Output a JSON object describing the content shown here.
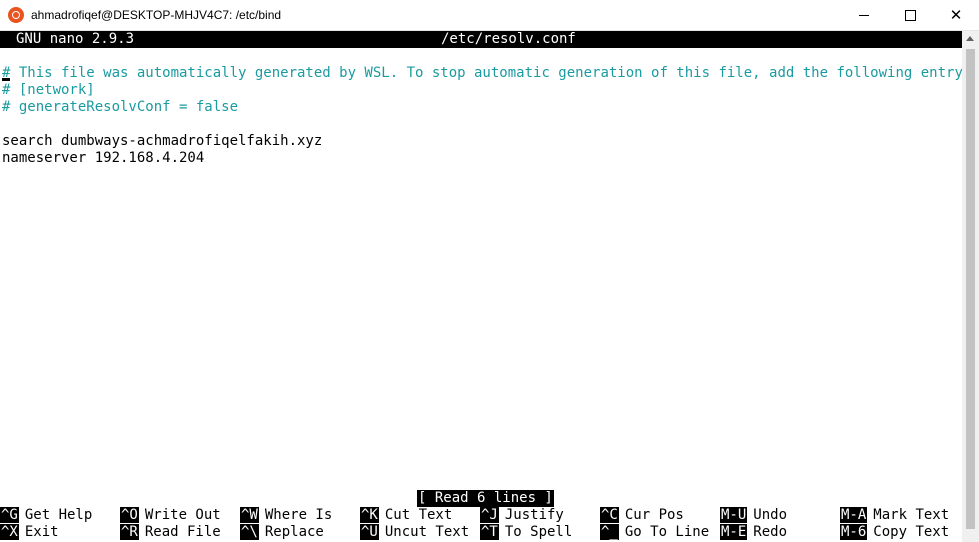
{
  "window": {
    "title": "ahmadrofiqef@DESKTOP-MHJV4C7: /etc/bind",
    "icon": "ubuntu-icon",
    "close_glyph": "✕"
  },
  "editor": {
    "version": "GNU nano 2.9.3",
    "filename": "/etc/resolv.conf",
    "lines": [
      "# This file was automatically generated by WSL. To stop automatic generation of this file, add the following entry to /$",
      "# [network]",
      "# generateResolvConf = false",
      "",
      "search dumbways-achmadrofiqelfakih.xyz",
      "nameserver 192.168.4.204"
    ],
    "status": "[ Read 6 lines ]"
  },
  "shortcuts": {
    "row1": [
      {
        "key": "^G",
        "label": "Get Help"
      },
      {
        "key": "^O",
        "label": "Write Out"
      },
      {
        "key": "^W",
        "label": "Where Is"
      },
      {
        "key": "^K",
        "label": "Cut Text"
      },
      {
        "key": "^J",
        "label": "Justify"
      },
      {
        "key": "^C",
        "label": "Cur Pos"
      },
      {
        "key": "M-U",
        "label": "Undo"
      },
      {
        "key": "M-A",
        "label": "Mark Text"
      }
    ],
    "row2": [
      {
        "key": "^X",
        "label": "Exit"
      },
      {
        "key": "^R",
        "label": "Read File"
      },
      {
        "key": "^\\",
        "label": "Replace"
      },
      {
        "key": "^U",
        "label": "Uncut Text"
      },
      {
        "key": "^T",
        "label": "To Spell"
      },
      {
        "key": "^_",
        "label": "Go To Line"
      },
      {
        "key": "M-E",
        "label": "Redo"
      },
      {
        "key": "M-6",
        "label": "Copy Text"
      }
    ]
  },
  "colors": {
    "comment": "#1a9ba0",
    "accent": "#e95420"
  }
}
